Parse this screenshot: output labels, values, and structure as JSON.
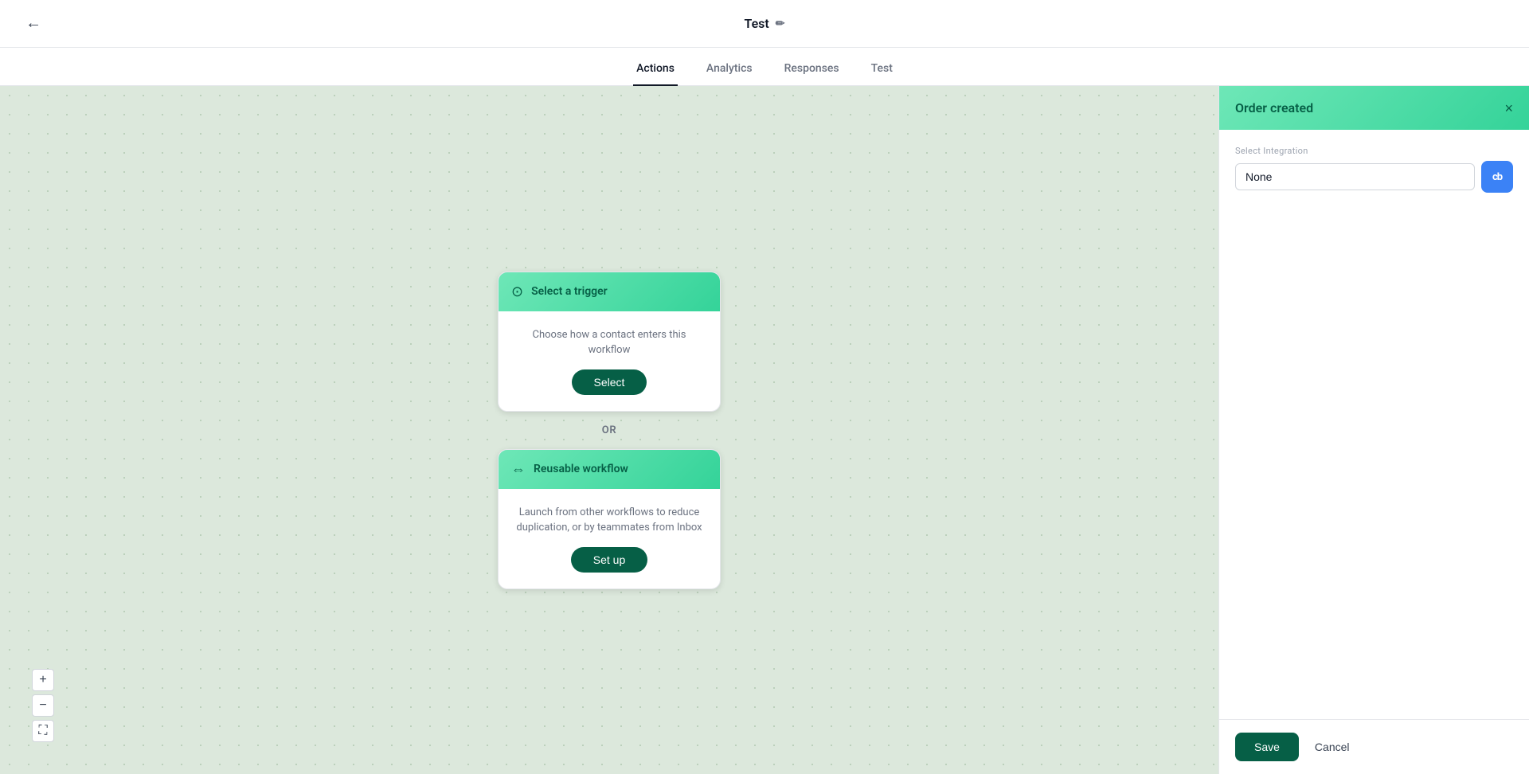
{
  "topbar": {
    "back_icon": "←",
    "title": "Test",
    "edit_icon": "✏"
  },
  "tabs": [
    {
      "id": "actions",
      "label": "Actions",
      "active": true
    },
    {
      "id": "analytics",
      "label": "Analytics",
      "active": false
    },
    {
      "id": "responses",
      "label": "Responses",
      "active": false
    },
    {
      "id": "test",
      "label": "Test",
      "active": false
    }
  ],
  "canvas": {
    "or_label": "OR",
    "trigger_card": {
      "header_icon": "⊙",
      "title": "Select a trigger",
      "description": "Choose how a contact enters this workflow",
      "button_label": "Select"
    },
    "reusable_card": {
      "header_icon": "⇔",
      "title": "Reusable workflow",
      "description": "Launch from other workflows to reduce duplication, or by teammates from Inbox",
      "button_label": "Set up"
    }
  },
  "zoom_controls": {
    "plus": "+",
    "minus": "−",
    "fit": "⛶"
  },
  "right_panel": {
    "title": "Order created",
    "close_icon": "×",
    "integration_label": "Select Integration",
    "integration_value": "None",
    "cb_logo_text": "cb",
    "save_label": "Save",
    "cancel_label": "Cancel"
  }
}
